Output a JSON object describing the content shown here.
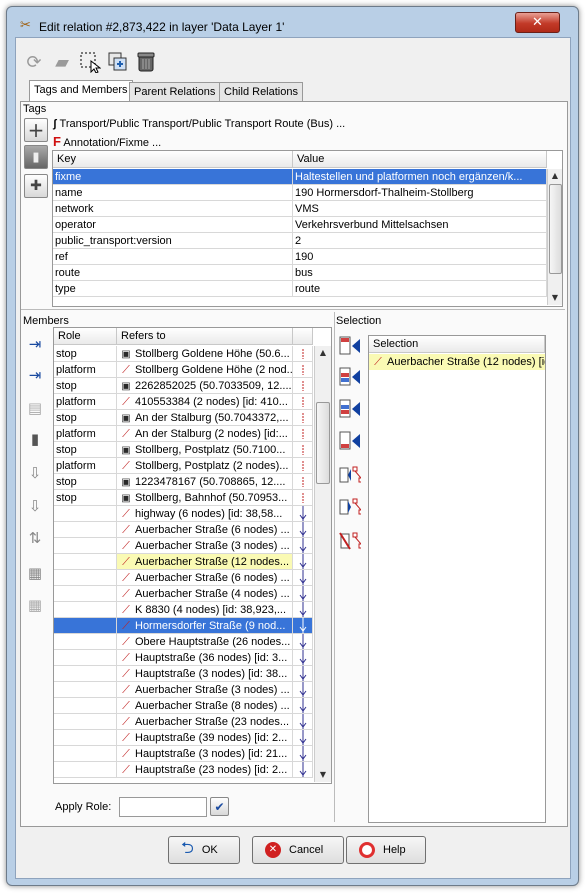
{
  "window": {
    "title": "Edit relation #2,873,422 in layer 'Data Layer 1'",
    "close_label": "✕"
  },
  "tabs": [
    "Tags and Members",
    "Parent Relations",
    "Child Relations"
  ],
  "tags": {
    "label": "Tags",
    "presets": [
      "Transport/Public Transport/Public Transport Route (Bus) ...",
      "Annotation/Fixme ..."
    ],
    "columns": [
      "Key",
      "Value"
    ],
    "rows": [
      {
        "key": "fixme",
        "value": "Haltestellen und platformen noch ergänzen/k..."
      },
      {
        "key": "name",
        "value": "190 Hormersdorf-Thalheim-Stollberg"
      },
      {
        "key": "network",
        "value": "VMS"
      },
      {
        "key": "operator",
        "value": "Verkehrsverbund Mittelsachsen"
      },
      {
        "key": "public_transport:version",
        "value": "2"
      },
      {
        "key": "ref",
        "value": "190"
      },
      {
        "key": "route",
        "value": "bus"
      },
      {
        "key": "type",
        "value": "route"
      }
    ]
  },
  "members": {
    "label": "Members",
    "columns": [
      "Role",
      "Refers to"
    ],
    "rows": [
      {
        "role": "stop",
        "icon": "bus-stop-icon",
        "ref": "Stollberg Goldene Höhe (50.6..."
      },
      {
        "role": "platform",
        "icon": "way-icon",
        "ref": "Stollberg Goldene Höhe (2 nod..."
      },
      {
        "role": "stop",
        "icon": "bus-stop-icon",
        "ref": "2262852025 (50.7033509, 12...."
      },
      {
        "role": "platform",
        "icon": "way-icon",
        "ref": "410553384 (2 nodes) [id: 410..."
      },
      {
        "role": "stop",
        "icon": "bus-stop-icon",
        "ref": "An der Stalburg (50.7043372,..."
      },
      {
        "role": "platform",
        "icon": "way-icon",
        "ref": "An der Stalburg (2 nodes) [id:..."
      },
      {
        "role": "stop",
        "icon": "bus-stop-icon",
        "ref": "Stollberg, Postplatz (50.7100..."
      },
      {
        "role": "platform",
        "icon": "way-icon",
        "ref": "Stollberg, Postplatz (2 nodes)..."
      },
      {
        "role": "stop",
        "icon": "bus-stop-icon",
        "ref": "1223478167 (50.708865, 12...."
      },
      {
        "role": "stop",
        "icon": "bus-stop-icon",
        "ref": "Stollberg, Bahnhof (50.70953..."
      },
      {
        "role": "",
        "icon": "way-icon",
        "ref": "highway (6 nodes) [id: 38,58..."
      },
      {
        "role": "",
        "icon": "way-icon",
        "ref": "Auerbacher Straße (6 nodes) ..."
      },
      {
        "role": "",
        "icon": "way-icon",
        "ref": "Auerbacher Straße (3 nodes) ..."
      },
      {
        "role": "",
        "icon": "way-icon",
        "ref": "Auerbacher Straße (12 nodes..."
      },
      {
        "role": "",
        "icon": "way-icon",
        "ref": "Auerbacher Straße (6 nodes) ..."
      },
      {
        "role": "",
        "icon": "way-icon",
        "ref": "Auerbacher Straße (4 nodes) ..."
      },
      {
        "role": "",
        "icon": "way-icon",
        "ref": "K 8830 (4 nodes) [id: 38,923,..."
      },
      {
        "role": "",
        "icon": "way-icon",
        "ref": "Hormersdorfer Straße (9 nod..."
      },
      {
        "role": "",
        "icon": "way-icon",
        "ref": "Obere Hauptstraße (26 nodes..."
      },
      {
        "role": "",
        "icon": "way-icon",
        "ref": "Hauptstraße (36 nodes) [id: 3..."
      },
      {
        "role": "",
        "icon": "way-icon",
        "ref": "Hauptstraße (3 nodes) [id: 38..."
      },
      {
        "role": "",
        "icon": "way-icon",
        "ref": "Auerbacher Straße (3 nodes) ..."
      },
      {
        "role": "",
        "icon": "way-icon",
        "ref": "Auerbacher Straße (8 nodes) ..."
      },
      {
        "role": "",
        "icon": "way-icon",
        "ref": "Auerbacher Straße (23 nodes..."
      },
      {
        "role": "",
        "icon": "way-icon",
        "ref": "Hauptstraße (39 nodes) [id: 2..."
      },
      {
        "role": "",
        "icon": "way-icon",
        "ref": "Hauptstraße (3 nodes) [id: 21..."
      },
      {
        "role": "",
        "icon": "way-icon",
        "ref": "Hauptstraße (23 nodes) [id: 2..."
      }
    ],
    "selected_row": 17,
    "highlighted_row": 13,
    "apply_role_label": "Apply Role:",
    "apply_role_value": ""
  },
  "selection": {
    "label": "Selection",
    "column": "Selection",
    "rows": [
      "Auerbacher Straße (12 nodes) [id"
    ]
  },
  "buttons": {
    "ok": "OK",
    "cancel": "Cancel",
    "help": "Help"
  },
  "colors": {
    "selected_row": "#3874d8",
    "highlight_row": "#fafab4"
  }
}
